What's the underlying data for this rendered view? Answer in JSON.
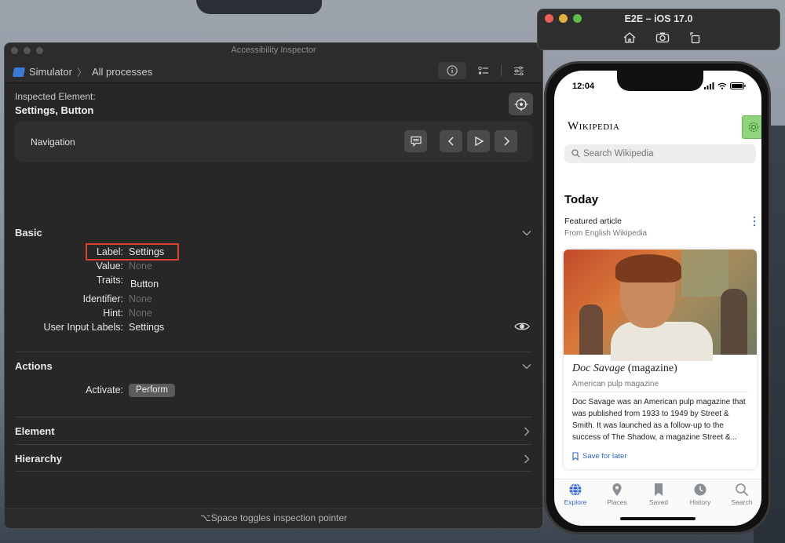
{
  "colors": {
    "highlight_red": "#d9412e",
    "accent_blue": "#3366cc",
    "gear_green": "#8ed57b"
  },
  "inspector": {
    "window_title": "Accessibility Inspector",
    "breadcrumb": {
      "target": "Simulator",
      "scope": "All processes"
    },
    "toolbar_icons": [
      "info-icon",
      "audit-icon",
      "settings-sliders-icon"
    ],
    "inspected_label": "Inspected Element:",
    "inspected_value": "Settings, Button",
    "navigation": {
      "label": "Navigation",
      "buttons": [
        "speech-icon",
        "previous-icon",
        "play-icon",
        "next-icon"
      ]
    },
    "sections": {
      "basic": {
        "title": "Basic",
        "props": {
          "label": {
            "key": "Label:",
            "value": "Settings"
          },
          "value": {
            "key": "Value:",
            "value": "None"
          },
          "traits": {
            "key": "Traits:",
            "value": "Button"
          },
          "identifier": {
            "key": "Identifier:",
            "value": "None"
          },
          "hint": {
            "key": "Hint:",
            "value": "None"
          },
          "user_input_labels": {
            "key": "User Input Labels:",
            "value": "Settings"
          }
        }
      },
      "actions": {
        "title": "Actions",
        "activate_key": "Activate:",
        "perform_label": "Perform"
      },
      "element": {
        "title": "Element"
      },
      "hierarchy": {
        "title": "Hierarchy"
      }
    },
    "footer": "⌥Space toggles inspection pointer"
  },
  "simulator": {
    "window_title": "E2E – iOS 17.0",
    "tools": [
      "home-icon",
      "screenshot-icon",
      "rotate-icon"
    ]
  },
  "app": {
    "status_time": "12:04",
    "logo": "Wikipedia",
    "search_placeholder": "Search Wikipedia",
    "section_title": "Today",
    "featured_title": "Featured article",
    "featured_sub": "From English Wikipedia",
    "article": {
      "title_italic": "Doc Savage",
      "title_rest": " (magazine)",
      "description": "American pulp magazine",
      "extract": "Doc Savage was an American pulp magazine that was published from 1933 to 1949 by Street & Smith. It was launched as a follow-up to the success of The Shadow, a magazine Street &...",
      "save_label": "Save for later"
    },
    "tabs": [
      {
        "label": "Explore",
        "icon": "globe-icon",
        "active": true
      },
      {
        "label": "Places",
        "icon": "map-pin-icon"
      },
      {
        "label": "Saved",
        "icon": "bookmark-icon"
      },
      {
        "label": "History",
        "icon": "clock-icon"
      },
      {
        "label": "Search",
        "icon": "search-icon"
      }
    ]
  }
}
